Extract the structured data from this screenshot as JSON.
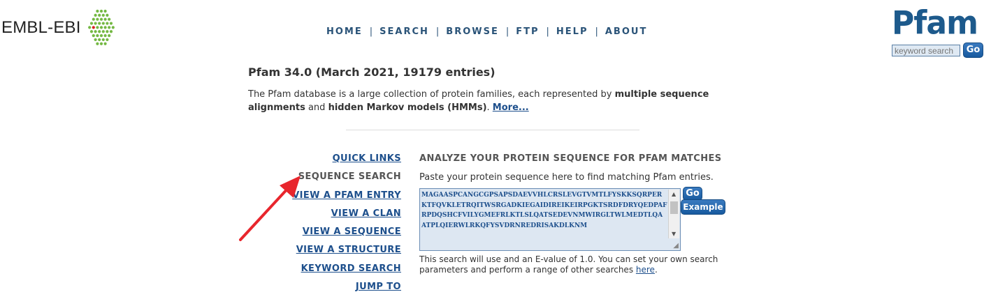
{
  "ebi": {
    "logo_text": "EMBL-EBI",
    "icon": "hexagon-dots-icon"
  },
  "nav": {
    "items": [
      "HOME",
      "SEARCH",
      "BROWSE",
      "FTP",
      "HELP",
      "ABOUT"
    ],
    "separator": "|"
  },
  "pfam": {
    "logo_text": "Pfam",
    "keyword_placeholder": "keyword search",
    "go_label": "Go"
  },
  "release": {
    "title": "Pfam 34.0 (March 2021, 19179 entries)"
  },
  "intro": {
    "text1": "The Pfam database is a large collection of protein families, each represented by ",
    "bold1": "multiple sequence alignments",
    "text2": " and ",
    "bold2": "hidden Markov models (HMMs)",
    "text3": ". ",
    "more_link": "More..."
  },
  "quick_links": {
    "items": [
      "QUICK LINKS",
      "SEQUENCE SEARCH",
      "VIEW A PFAM ENTRY",
      "VIEW A CLAN",
      "VIEW A SEQUENCE",
      "VIEW A STRUCTURE",
      "KEYWORD SEARCH",
      "JUMP TO"
    ],
    "active": "SEQUENCE SEARCH"
  },
  "analyze": {
    "title": "ANALYZE YOUR PROTEIN SEQUENCE FOR PFAM MATCHES",
    "description": "Paste your protein sequence here to find matching Pfam entries.",
    "sequence": "MAGAASPCANGCGPSAPSDAEVVHLCRSLEVGTVMTLFYSKKSQRPERKTFQVKLETRQITWSRGADKIEGAIDIREIKEIRPGKTSRDFDRYQEDPAFRPDQSHCFVILYGMEFRLKTLSLQATSEDEVNMWIRGLTWLMEDTLQAATPLQIERWLRKQFYSVDRNREDRISAKDLKNM",
    "go_label": "Go",
    "example_label": "Example",
    "note_text": "This search will use and an E-value of 1.0. You can set your own search parameters and perform a range of other searches ",
    "note_link": "here",
    "note_end": "."
  },
  "colors": {
    "link": "#1d4f8c",
    "nav": "#2a5378",
    "button": "#175a9f",
    "arrow": "#e8262d",
    "ebi_green": "#74b843",
    "ebi_red": "#d8201e"
  }
}
